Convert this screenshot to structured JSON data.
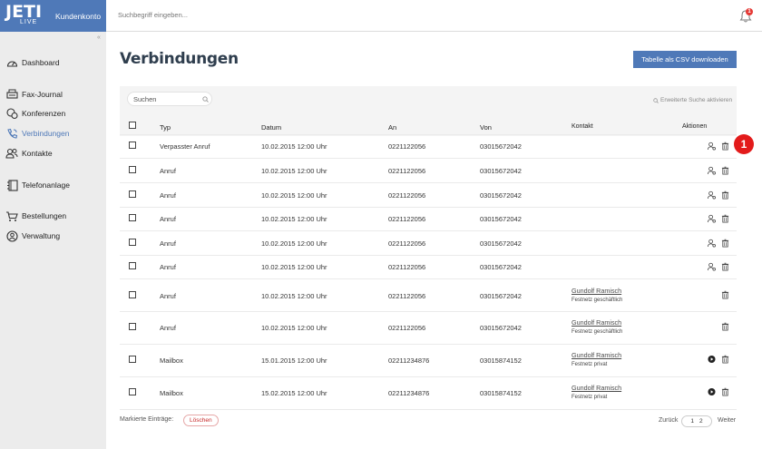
{
  "header": {
    "logo_text": "JETI",
    "logo_sub": "LIVE",
    "account_label": "Kundenkonto",
    "search_placeholder": "Suchbegriff eingeben...",
    "notification_count": "1"
  },
  "sidebar": {
    "collapse_glyph": "«",
    "items": [
      {
        "label": "Dashboard",
        "icon": "dashboard-icon"
      },
      {
        "label": "Fax-Journal",
        "icon": "fax-icon"
      },
      {
        "label": "Konferenzen",
        "icon": "conference-icon"
      },
      {
        "label": "Verbindungen",
        "icon": "phone-icon",
        "active": true
      },
      {
        "label": "Kontakte",
        "icon": "contacts-icon"
      },
      {
        "label": "Telefonanlage",
        "icon": "phonebook-icon"
      },
      {
        "label": "Bestellungen",
        "icon": "cart-icon"
      },
      {
        "label": "Verwaltung",
        "icon": "admin-icon"
      }
    ]
  },
  "main": {
    "title": "Verbindungen",
    "csv_button": "Tabelle als CSV downloaden",
    "search_placeholder": "Suchen",
    "advanced_search": "Erweiterte Suche aktivieren",
    "columns": [
      "Typ",
      "Datum",
      "An",
      "Von",
      "Kontakt",
      "Aktionen"
    ],
    "rows": [
      {
        "typ": "Verpasster Anruf",
        "datum": "10.02.2015 12:00 Uhr",
        "an": "0221122056",
        "von": "03015672042",
        "kontakt": "",
        "kontakt_sub": "",
        "actions": [
          "add-contact-icon",
          "trash-icon"
        ]
      },
      {
        "typ": "Anruf",
        "datum": "10.02.2015 12:00 Uhr",
        "an": "0221122056",
        "von": "03015672042",
        "kontakt": "",
        "kontakt_sub": "",
        "actions": [
          "add-contact-icon",
          "trash-icon"
        ]
      },
      {
        "typ": "Anruf",
        "datum": "10.02.2015 12:00 Uhr",
        "an": "0221122056",
        "von": "03015672042",
        "kontakt": "",
        "kontakt_sub": "",
        "actions": [
          "add-contact-icon",
          "trash-icon"
        ]
      },
      {
        "typ": "Anruf",
        "datum": "10.02.2015 12:00 Uhr",
        "an": "0221122056",
        "von": "03015672042",
        "kontakt": "",
        "kontakt_sub": "",
        "actions": [
          "add-contact-icon",
          "trash-icon"
        ]
      },
      {
        "typ": "Anruf",
        "datum": "10.02.2015 12:00 Uhr",
        "an": "0221122056",
        "von": "03015672042",
        "kontakt": "",
        "kontakt_sub": "",
        "actions": [
          "add-contact-icon",
          "trash-icon"
        ]
      },
      {
        "typ": "Anruf",
        "datum": "10.02.2015 12:00 Uhr",
        "an": "0221122056",
        "von": "03015672042",
        "kontakt": "",
        "kontakt_sub": "",
        "actions": [
          "add-contact-icon",
          "trash-icon"
        ]
      },
      {
        "typ": "Anruf",
        "datum": "10.02.2015 12:00 Uhr",
        "an": "0221122056",
        "von": "03015672042",
        "kontakt": "Gundolf Ramisch",
        "kontakt_sub": "Festnetz geschäftlich",
        "actions": [
          "trash-icon"
        ]
      },
      {
        "typ": "Anruf",
        "datum": "10.02.2015 12:00 Uhr",
        "an": "0221122056",
        "von": "03015672042",
        "kontakt": "Gundolf Ramisch",
        "kontakt_sub": "Festnetz geschäftlich",
        "actions": [
          "trash-icon"
        ]
      },
      {
        "typ": "Mailbox",
        "datum": "15.01.2015 12:00 Uhr",
        "an": "02211234876",
        "von": "03015874152",
        "kontakt": "Gundolf Ramisch",
        "kontakt_sub": "Festnetz privat",
        "actions": [
          "play-icon",
          "trash-icon"
        ]
      },
      {
        "typ": "Mailbox",
        "datum": "15.02.2015 12:00 Uhr",
        "an": "02211234876",
        "von": "03015874152",
        "kontakt": "Gundolf Ramisch",
        "kontakt_sub": "Festnetz privat",
        "actions": [
          "play-icon",
          "trash-icon"
        ]
      }
    ],
    "marker_label": "1"
  },
  "footer": {
    "marked_label": "Markierte Einträge:",
    "delete_button": "Löschen",
    "prev": "Zurück",
    "pages": [
      "1",
      "2"
    ],
    "next": "Weiter"
  }
}
